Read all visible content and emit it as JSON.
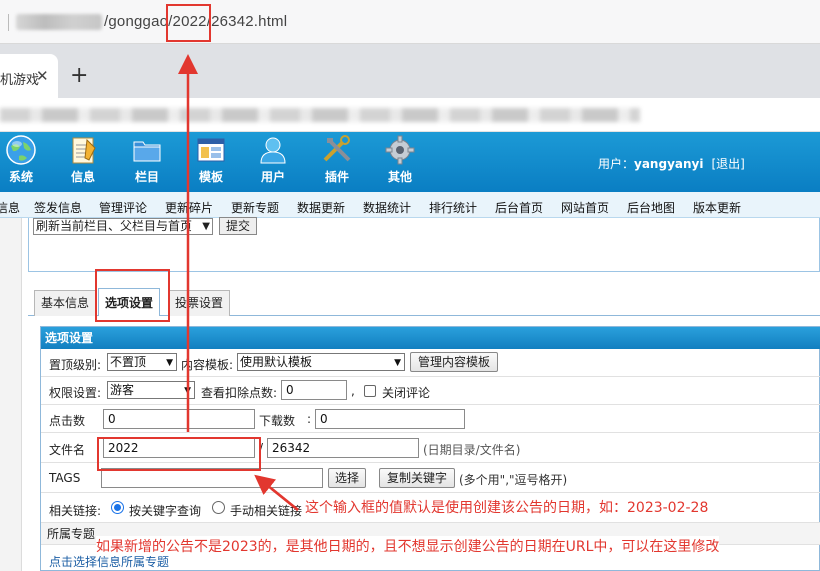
{
  "browser": {
    "url_suffix": "/gonggao/2022/26342.html",
    "tab_title": "机游戏",
    "tab_close": "✕",
    "new_tab": "+"
  },
  "header": {
    "nav": [
      {
        "label": "系统",
        "icon": "globe-icon"
      },
      {
        "label": "信息",
        "icon": "notepad-icon"
      },
      {
        "label": "栏目",
        "icon": "folder-icon"
      },
      {
        "label": "模板",
        "icon": "window-template-icon"
      },
      {
        "label": "用户",
        "icon": "user-icon"
      },
      {
        "label": "插件",
        "icon": "tools-icon"
      },
      {
        "label": "其他",
        "icon": "gear-icon"
      }
    ],
    "user_label": "用户：",
    "username": "yangyanyi",
    "logout": "[退出]"
  },
  "subnav": [
    "信息",
    "签发信息",
    "管理评论",
    "更新碎片",
    "更新专题",
    "数据更新",
    "数据统计",
    "排行统计",
    "后台首页",
    "网站首页",
    "后台地图",
    "版本更新"
  ],
  "top_form": {
    "refresh_select": "刷新当前栏目、父栏目与首页",
    "submit": "提交"
  },
  "tabs": [
    "基本信息",
    "选项设置",
    "投票设置"
  ],
  "panel": {
    "title": "选项设置",
    "top_level_label": "置顶级别:",
    "top_level_value": "不置顶",
    "content_template_label": "内容模板:",
    "content_template_value": "使用默认模板",
    "manage_template_btn": "管理内容模板",
    "permission_label": "权限设置:",
    "permission_value": "游客",
    "deduct_points_label": "查看扣除点数:",
    "deduct_points_value": "0",
    "comma": ",",
    "close_comment_label": "关闭评论",
    "click_count_label": "点击数",
    "click_count_value": "0",
    "download_count_label": "下载数",
    "download_count_value": "0",
    "colon": ":",
    "filename_label": "文件名",
    "filename_dir_value": "2022",
    "slash": "/",
    "filename_value": "26342",
    "filename_hint": "(日期目录/文件名)",
    "tags_label": "TAGS",
    "tags_value": "",
    "select_btn": "选择",
    "copy_keywords_btn": "复制关键字",
    "tags_hint": "(多个用\",\"逗号格开)",
    "related_label": "相关链接:",
    "related_opt1": "按关键字查询",
    "related_opt2": "手动相关链接",
    "topic_label": "所属专题",
    "topic_link": "点击选择信息所属专题"
  },
  "annotations": {
    "note1": "这个输入框的值默认是使用创建该公告的日期，如：2023-02-28",
    "note2": "如果新增的公告不是2023的，是其他日期的，且不想显示创建公告的日期在URL中，可以在这里修改",
    "color": "#e2372f"
  }
}
